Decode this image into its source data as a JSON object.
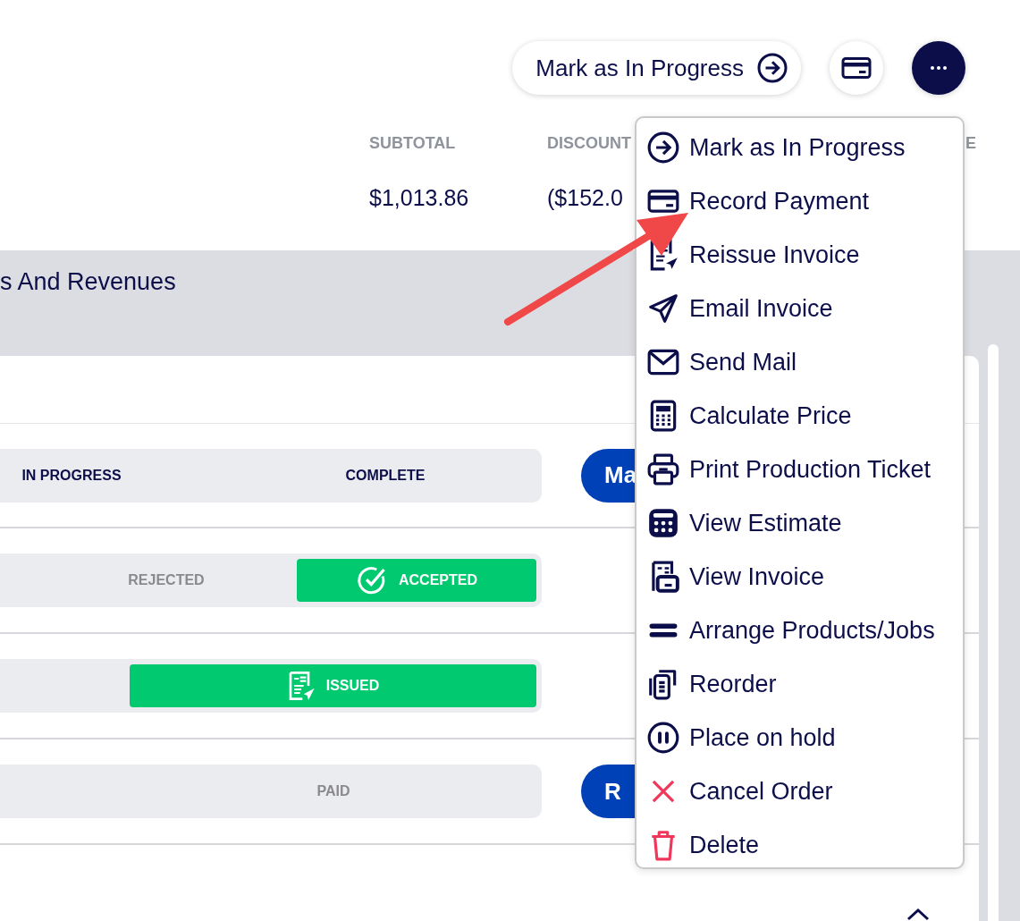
{
  "header_actions": {
    "primary": {
      "label": "Mark as In Progress"
    }
  },
  "totals": [
    {
      "label": "SUBTOTAL",
      "value": "$1,013.86"
    },
    {
      "label": "DISCOUNT",
      "value": "($152.0"
    },
    {
      "label": "E"
    }
  ],
  "section": {
    "title": "s And Revenues"
  },
  "status_rows": [
    {
      "segments": [
        {
          "label": "IN PROGRESS",
          "selected": false,
          "disabled": false
        },
        {
          "label": "COMPLETE",
          "selected": false,
          "disabled": false
        }
      ],
      "action": "Ma"
    },
    {
      "segments": [
        {
          "label": "REJECTED",
          "selected": false,
          "disabled": true
        },
        {
          "label": "ACCEPTED",
          "selected": true
        }
      ]
    },
    {
      "segments": [
        {
          "label": "ISSUED",
          "selected": true
        }
      ]
    },
    {
      "segments": [
        {
          "label": "PAID",
          "selected": false,
          "disabled": true
        }
      ],
      "action": "R"
    }
  ],
  "menu": {
    "items": [
      {
        "label": "Mark as In Progress"
      },
      {
        "label": "Record Payment"
      },
      {
        "label": "Reissue Invoice"
      },
      {
        "label": "Email Invoice"
      },
      {
        "label": "Send Mail"
      },
      {
        "label": "Calculate Price"
      },
      {
        "label": "Print Production Ticket"
      },
      {
        "label": "View Estimate"
      },
      {
        "label": "View Invoice"
      },
      {
        "label": "Arrange Products/Jobs"
      },
      {
        "label": "Reorder"
      },
      {
        "label": "Place on hold"
      },
      {
        "label": "Cancel Order"
      },
      {
        "label": "Delete"
      }
    ]
  }
}
